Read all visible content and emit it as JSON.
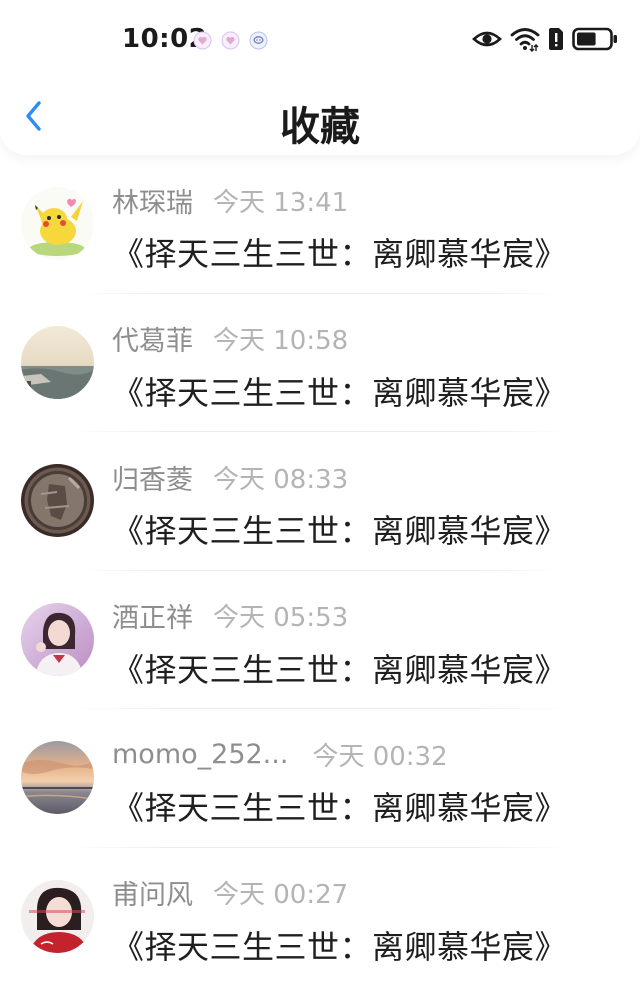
{
  "status_bar": {
    "time": "10:02",
    "notification_icons": [
      "heart-notification-icon",
      "heart-notification-icon",
      "chat-notification-icon"
    ],
    "right_icons": [
      "eye-icon",
      "wifi-icon",
      "sim-alert-icon",
      "battery-icon"
    ],
    "battery_level": 0.6
  },
  "header": {
    "back_icon": "chevron-left-icon",
    "title": "收藏"
  },
  "items": [
    {
      "name": "林琛瑞",
      "time": "今天 13:41",
      "content": "《择天三生三世：离卿慕华宸》",
      "avatar": "pikachu"
    },
    {
      "name": "代葛菲",
      "time": "今天 10:58",
      "content": "《择天三生三世：离卿慕华宸》",
      "avatar": "seascape"
    },
    {
      "name": "归香菱",
      "time": "今天 08:33",
      "content": "《择天三生三世：离卿慕华宸》",
      "avatar": "coin"
    },
    {
      "name": "酒正祥",
      "time": "今天 05:53",
      "content": "《择天三生三世：离卿慕华宸》",
      "avatar": "girl"
    },
    {
      "name": "momo_252...",
      "time": "今天 00:32",
      "content": "《择天三生三世：离卿慕华宸》",
      "avatar": "sunset"
    },
    {
      "name": "甫问风",
      "time": "今天 00:27",
      "content": "《择天三生三世：离卿慕华宸》",
      "avatar": "portrait"
    }
  ],
  "colors": {
    "accent": "#2f8cf4",
    "name_text": "#8e8e8e",
    "time_text": "#b4b4b4",
    "content_text": "#1f1f1f"
  }
}
